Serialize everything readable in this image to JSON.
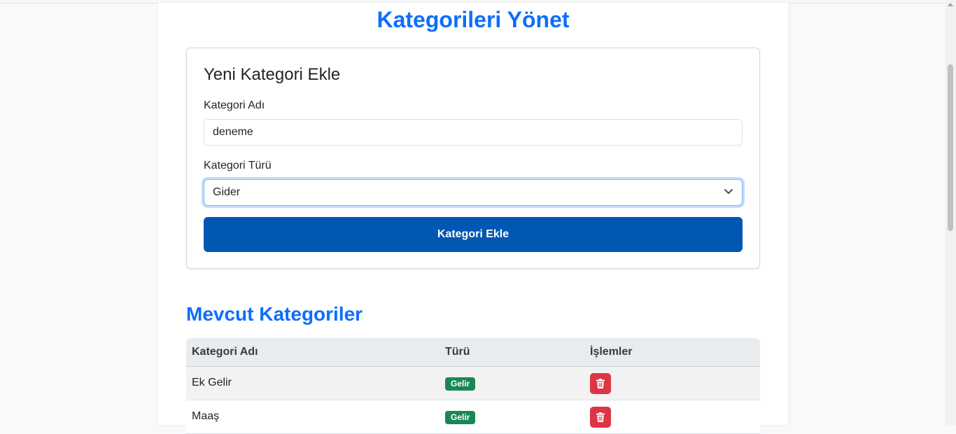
{
  "page": {
    "title": "Kategorileri Yönet"
  },
  "form": {
    "title": "Yeni Kategori Ekle",
    "name_label": "Kategori Adı",
    "name_value": "deneme",
    "type_label": "Kategori Türü",
    "type_value": "Gider",
    "submit_label": "Kategori Ekle"
  },
  "list": {
    "title": "Mevcut Kategoriler",
    "columns": [
      "Kategori Adı",
      "Türü",
      "İşlemler"
    ],
    "rows": [
      {
        "name": "Ek Gelir",
        "type": "Gelir",
        "action_icon": "trash-icon"
      },
      {
        "name": "Maaş",
        "type": "Gelir",
        "action_icon": "trash-icon"
      }
    ]
  },
  "colors": {
    "accent": "#0d6efd",
    "primary_button": "#0257b3",
    "badge_income": "#198754",
    "danger": "#dc3545"
  }
}
